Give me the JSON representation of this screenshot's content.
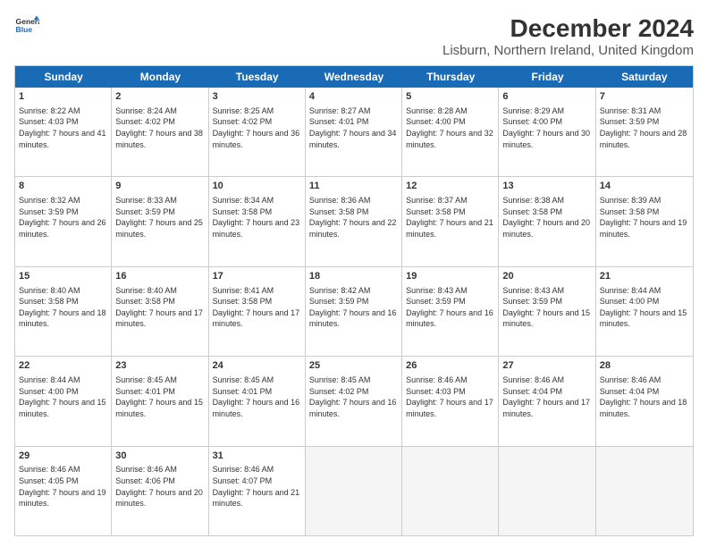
{
  "logo": {
    "line1": "General",
    "line2": "Blue"
  },
  "title": "December 2024",
  "subtitle": "Lisburn, Northern Ireland, United Kingdom",
  "days": [
    "Sunday",
    "Monday",
    "Tuesday",
    "Wednesday",
    "Thursday",
    "Friday",
    "Saturday"
  ],
  "weeks": [
    [
      {
        "day": "1",
        "sunrise": "8:22 AM",
        "sunset": "4:03 PM",
        "daylight": "7 hours and 41 minutes."
      },
      {
        "day": "2",
        "sunrise": "8:24 AM",
        "sunset": "4:02 PM",
        "daylight": "7 hours and 38 minutes."
      },
      {
        "day": "3",
        "sunrise": "8:25 AM",
        "sunset": "4:02 PM",
        "daylight": "7 hours and 36 minutes."
      },
      {
        "day": "4",
        "sunrise": "8:27 AM",
        "sunset": "4:01 PM",
        "daylight": "7 hours and 34 minutes."
      },
      {
        "day": "5",
        "sunrise": "8:28 AM",
        "sunset": "4:00 PM",
        "daylight": "7 hours and 32 minutes."
      },
      {
        "day": "6",
        "sunrise": "8:29 AM",
        "sunset": "4:00 PM",
        "daylight": "7 hours and 30 minutes."
      },
      {
        "day": "7",
        "sunrise": "8:31 AM",
        "sunset": "3:59 PM",
        "daylight": "7 hours and 28 minutes."
      }
    ],
    [
      {
        "day": "8",
        "sunrise": "8:32 AM",
        "sunset": "3:59 PM",
        "daylight": "7 hours and 26 minutes."
      },
      {
        "day": "9",
        "sunrise": "8:33 AM",
        "sunset": "3:59 PM",
        "daylight": "7 hours and 25 minutes."
      },
      {
        "day": "10",
        "sunrise": "8:34 AM",
        "sunset": "3:58 PM",
        "daylight": "7 hours and 23 minutes."
      },
      {
        "day": "11",
        "sunrise": "8:36 AM",
        "sunset": "3:58 PM",
        "daylight": "7 hours and 22 minutes."
      },
      {
        "day": "12",
        "sunrise": "8:37 AM",
        "sunset": "3:58 PM",
        "daylight": "7 hours and 21 minutes."
      },
      {
        "day": "13",
        "sunrise": "8:38 AM",
        "sunset": "3:58 PM",
        "daylight": "7 hours and 20 minutes."
      },
      {
        "day": "14",
        "sunrise": "8:39 AM",
        "sunset": "3:58 PM",
        "daylight": "7 hours and 19 minutes."
      }
    ],
    [
      {
        "day": "15",
        "sunrise": "8:40 AM",
        "sunset": "3:58 PM",
        "daylight": "7 hours and 18 minutes."
      },
      {
        "day": "16",
        "sunrise": "8:40 AM",
        "sunset": "3:58 PM",
        "daylight": "7 hours and 17 minutes."
      },
      {
        "day": "17",
        "sunrise": "8:41 AM",
        "sunset": "3:58 PM",
        "daylight": "7 hours and 17 minutes."
      },
      {
        "day": "18",
        "sunrise": "8:42 AM",
        "sunset": "3:59 PM",
        "daylight": "7 hours and 16 minutes."
      },
      {
        "day": "19",
        "sunrise": "8:43 AM",
        "sunset": "3:59 PM",
        "daylight": "7 hours and 16 minutes."
      },
      {
        "day": "20",
        "sunrise": "8:43 AM",
        "sunset": "3:59 PM",
        "daylight": "7 hours and 15 minutes."
      },
      {
        "day": "21",
        "sunrise": "8:44 AM",
        "sunset": "4:00 PM",
        "daylight": "7 hours and 15 minutes."
      }
    ],
    [
      {
        "day": "22",
        "sunrise": "8:44 AM",
        "sunset": "4:00 PM",
        "daylight": "7 hours and 15 minutes."
      },
      {
        "day": "23",
        "sunrise": "8:45 AM",
        "sunset": "4:01 PM",
        "daylight": "7 hours and 15 minutes."
      },
      {
        "day": "24",
        "sunrise": "8:45 AM",
        "sunset": "4:01 PM",
        "daylight": "7 hours and 16 minutes."
      },
      {
        "day": "25",
        "sunrise": "8:45 AM",
        "sunset": "4:02 PM",
        "daylight": "7 hours and 16 minutes."
      },
      {
        "day": "26",
        "sunrise": "8:46 AM",
        "sunset": "4:03 PM",
        "daylight": "7 hours and 17 minutes."
      },
      {
        "day": "27",
        "sunrise": "8:46 AM",
        "sunset": "4:04 PM",
        "daylight": "7 hours and 17 minutes."
      },
      {
        "day": "28",
        "sunrise": "8:46 AM",
        "sunset": "4:04 PM",
        "daylight": "7 hours and 18 minutes."
      }
    ],
    [
      {
        "day": "29",
        "sunrise": "8:46 AM",
        "sunset": "4:05 PM",
        "daylight": "7 hours and 19 minutes."
      },
      {
        "day": "30",
        "sunrise": "8:46 AM",
        "sunset": "4:06 PM",
        "daylight": "7 hours and 20 minutes."
      },
      {
        "day": "31",
        "sunrise": "8:46 AM",
        "sunset": "4:07 PM",
        "daylight": "7 hours and 21 minutes."
      },
      null,
      null,
      null,
      null
    ]
  ],
  "labels": {
    "sunrise": "Sunrise:",
    "sunset": "Sunset:",
    "daylight": "Daylight:"
  }
}
